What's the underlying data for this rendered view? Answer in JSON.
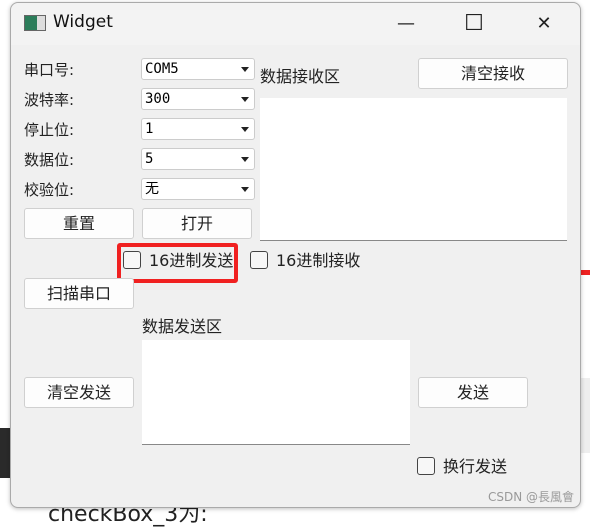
{
  "window": {
    "title": "Widget",
    "minimize": "—",
    "maximize": "☐",
    "close": "✕"
  },
  "labels": {
    "port": "串口号:",
    "baud": "波特率:",
    "stop": "停止位:",
    "data": "数据位:",
    "parity": "校验位:",
    "recv_area": "数据接收区",
    "send_area": "数据发送区"
  },
  "combos": {
    "port": "COM5",
    "baud": "300",
    "stop": "1",
    "data": "5",
    "parity": "无"
  },
  "buttons": {
    "reset": "重置",
    "open": "打开",
    "clear_recv": "清空接收",
    "scan": "扫描串口",
    "clear_send": "清空发送",
    "send": "发送"
  },
  "checkboxes": {
    "hex_send": "16进制发送",
    "hex_recv": "16进制接收",
    "newline_send": "换行发送"
  },
  "background_text": "checkBox_3为:",
  "watermark": "CSDN @長風會",
  "colors": {
    "highlight": "#f02020"
  }
}
